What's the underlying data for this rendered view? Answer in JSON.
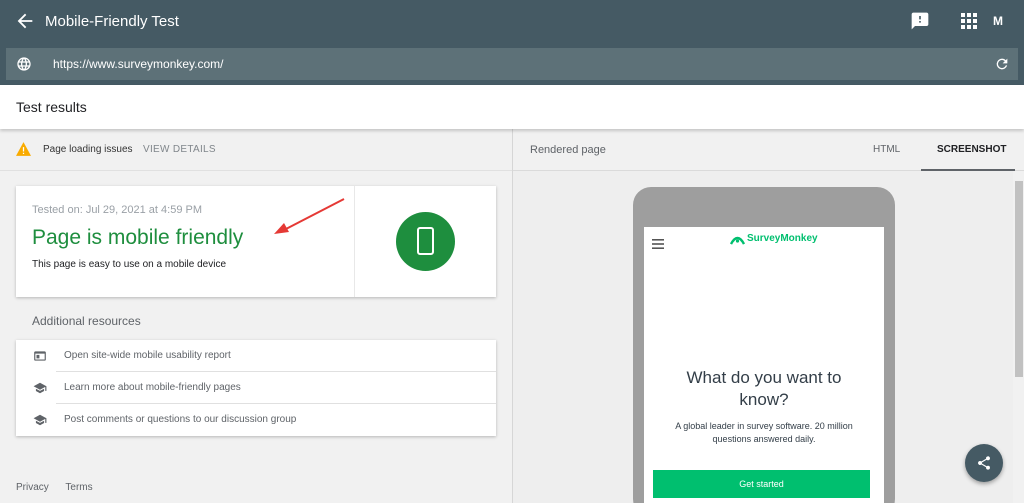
{
  "appbar": {
    "title": "Mobile-Friendly Test",
    "back_icon": "arrow-left-icon",
    "feedback_icon": "feedback-icon",
    "apps_icon": "apps-grid-icon",
    "avatar_letter": "M"
  },
  "urlbar": {
    "url": "https://www.surveymonkey.com/",
    "globe_icon": "globe-icon",
    "reload_icon": "refresh-icon"
  },
  "results": {
    "title": "Test results"
  },
  "issues": {
    "label": "Page loading issues",
    "view_details": "VIEW DETAILS",
    "icon": "warning-icon"
  },
  "result_card": {
    "tested_on": "Tested on: Jul 29, 2021 at 4:59 PM",
    "headline": "Page is mobile friendly",
    "subtext": "This page is easy to use on a mobile device",
    "icon": "phone-icon"
  },
  "additional": {
    "title": "Additional resources",
    "items": [
      {
        "label": "Open site-wide mobile usability report",
        "icon": "report-icon"
      },
      {
        "label": "Learn more about mobile-friendly pages",
        "icon": "school-icon"
      },
      {
        "label": "Post comments or questions to our discussion group",
        "icon": "school-icon"
      }
    ]
  },
  "footer": {
    "privacy": "Privacy",
    "terms": "Terms"
  },
  "right_panel": {
    "rendered_label": "Rendered page",
    "tabs": [
      {
        "label": "HTML"
      },
      {
        "label": "SCREENSHOT",
        "active": true
      }
    ]
  },
  "preview": {
    "brand": "SurveyMonkey",
    "headline": "What do you want to know?",
    "description": "A global leader in survey software. 20 million questions answered daily.",
    "cta": "Get started",
    "brand_color": "#00bf6f"
  },
  "colors": {
    "appbar": "#455a64",
    "success": "#1e8e3e",
    "warning": "#f9ab00"
  }
}
